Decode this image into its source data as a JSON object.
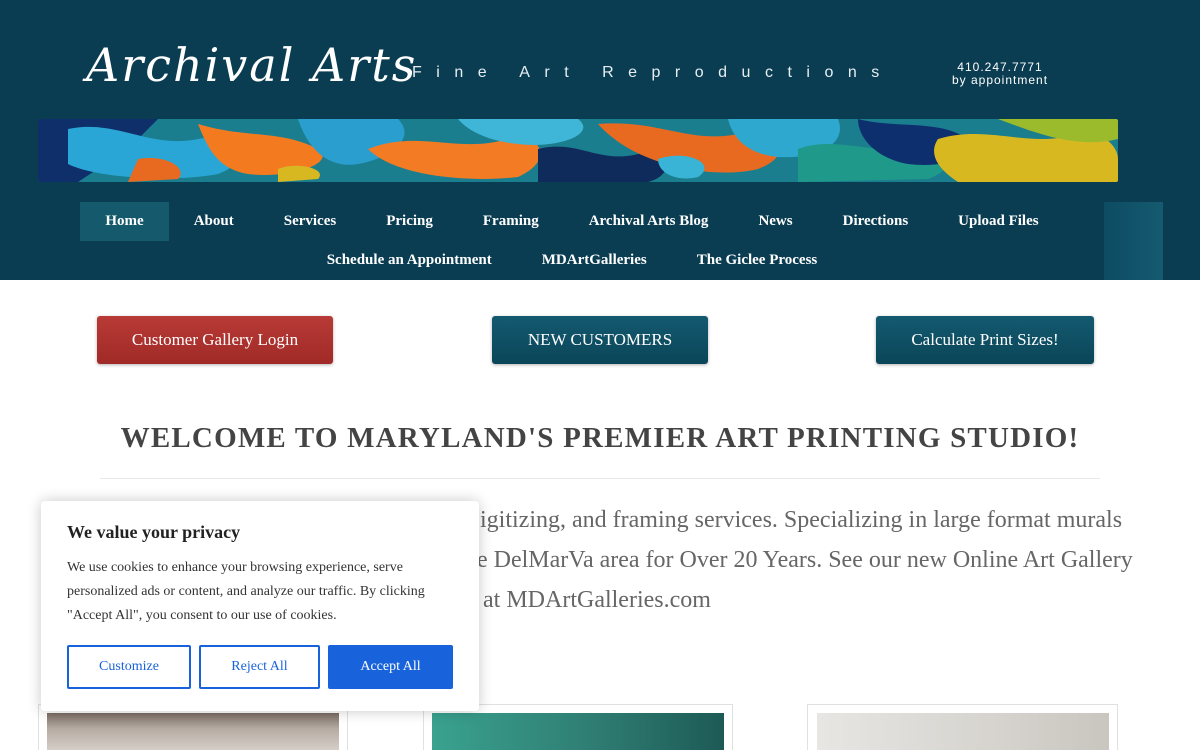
{
  "header": {
    "logo": "Archival Arts",
    "tagline": "Fine Art Reproductions",
    "phone": "410.247.7771",
    "appointment": "by appointment"
  },
  "nav": {
    "row1": [
      "Home",
      "About",
      "Services",
      "Pricing",
      "Framing",
      "Archival Arts Blog",
      "News",
      "Directions",
      "Upload Files"
    ],
    "row2": [
      "Schedule an Appointment",
      "MDArtGalleries",
      "The Giclee Process"
    ],
    "active": "Home"
  },
  "cta": {
    "login": "Customer Gallery Login",
    "new_customers": "NEW CUSTOMERS",
    "calculate": "Calculate Print Sizes!"
  },
  "main": {
    "welcome": "WELCOME TO MARYLAND'S PREMIER ART PRINTING STUDIO!",
    "intro_line1": "igitizing, and framing services. Specializing in large format murals",
    "intro_line2": "e DelMarVa area for Over 20 Years. See our new Online Art Gallery",
    "intro_line3": "at MDArtGalleries.com"
  },
  "cookie": {
    "title": "We value your privacy",
    "text": "We use cookies to enhance your browsing experience, serve personalized ads or content, and analyze our traffic. By clicking \"Accept All\", you consent to our use of cookies.",
    "customize": "Customize",
    "reject": "Reject All",
    "accept": "Accept All"
  },
  "colors": {
    "header_bg": "#0a3d52",
    "login_red": "#b83a36",
    "teal_button": "#0b4558",
    "cookie_blue": "#1863dc"
  }
}
